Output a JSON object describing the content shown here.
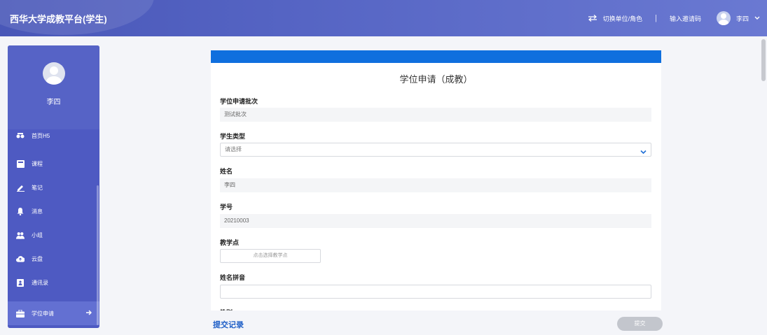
{
  "header": {
    "title": "西华大学成教平台(学生)",
    "switch_role_label": "切换单位/角色",
    "separator": "|",
    "invite_code_label": "输入邀请码",
    "user_name": "李四"
  },
  "sidebar": {
    "profile_name": "李四",
    "items": [
      {
        "label": "首页H5",
        "icon": "glasses-icon"
      },
      {
        "label": "课程",
        "icon": "book-icon"
      },
      {
        "label": "笔记",
        "icon": "pen-icon"
      },
      {
        "label": "消息",
        "icon": "bell-icon"
      },
      {
        "label": "小组",
        "icon": "group-icon"
      },
      {
        "label": "云盘",
        "icon": "cloud-upload-icon"
      },
      {
        "label": "通讯录",
        "icon": "address-book-icon"
      },
      {
        "label": "学位申请",
        "icon": "briefcase-icon",
        "active": true
      }
    ]
  },
  "form": {
    "title": "学位申请（成教）",
    "fields": {
      "batch_label": "学位申请批次",
      "batch_value": "测试批次",
      "student_type_label": "学生类型",
      "student_type_placeholder": "请选择",
      "name_label": "姓名",
      "name_value": "李四",
      "student_id_label": "学号",
      "student_id_value": "20210003",
      "teaching_point_label": "教学点",
      "teaching_point_button": "点击选择教学点",
      "pinyin_label": "姓名拼音",
      "gender_label": "性别"
    }
  },
  "footer": {
    "submit_record_label": "提交记录",
    "submit_label": "提交"
  },
  "colors": {
    "header": "#5665c4",
    "sidebar": "#4e5ac2",
    "accent_bar": "#0f6fde",
    "link": "#1f5fc7"
  }
}
